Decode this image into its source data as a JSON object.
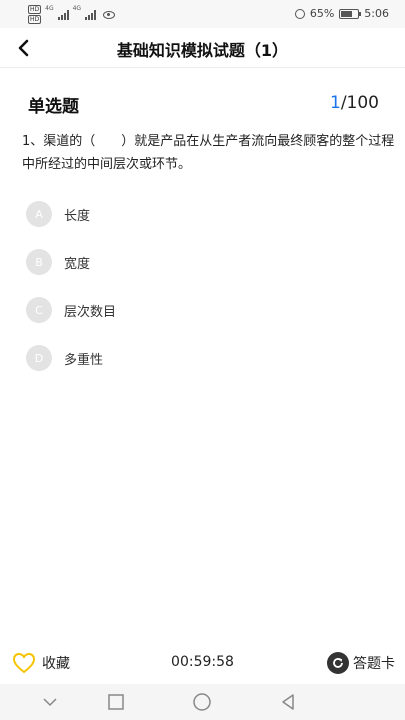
{
  "status_bar": {
    "sim1": "HD",
    "sim2": "HD",
    "net1": "4G",
    "net2": "4G",
    "battery": "65%",
    "time": "5:06",
    "battery_level": 0.65
  },
  "header": {
    "title": "基础知识模拟试题（1）",
    "back_icon": "chevron-left-icon"
  },
  "question_type": "单选题",
  "progress": {
    "current": "1",
    "total": "/100"
  },
  "question": {
    "text": "1、渠道的（　　）就是产品在从生产者流向最终顾客的整个过程中所经过的中间层次或环节。"
  },
  "options": [
    {
      "letter": "A",
      "text": "长度"
    },
    {
      "letter": "B",
      "text": "宽度"
    },
    {
      "letter": "C",
      "text": "层次数目"
    },
    {
      "letter": "D",
      "text": "多重性"
    }
  ],
  "bottom_bar": {
    "favorite_label": "收藏",
    "timer": "00:59:58",
    "answer_card_label": "答题卡",
    "favorite_icon": "heart-icon",
    "answer_card_icon": "refresh-icon",
    "accent": "#f5c400"
  },
  "nav_bar": {
    "icons": [
      "chevron-down-icon",
      "square-icon",
      "circle-icon",
      "triangle-back-icon"
    ]
  }
}
